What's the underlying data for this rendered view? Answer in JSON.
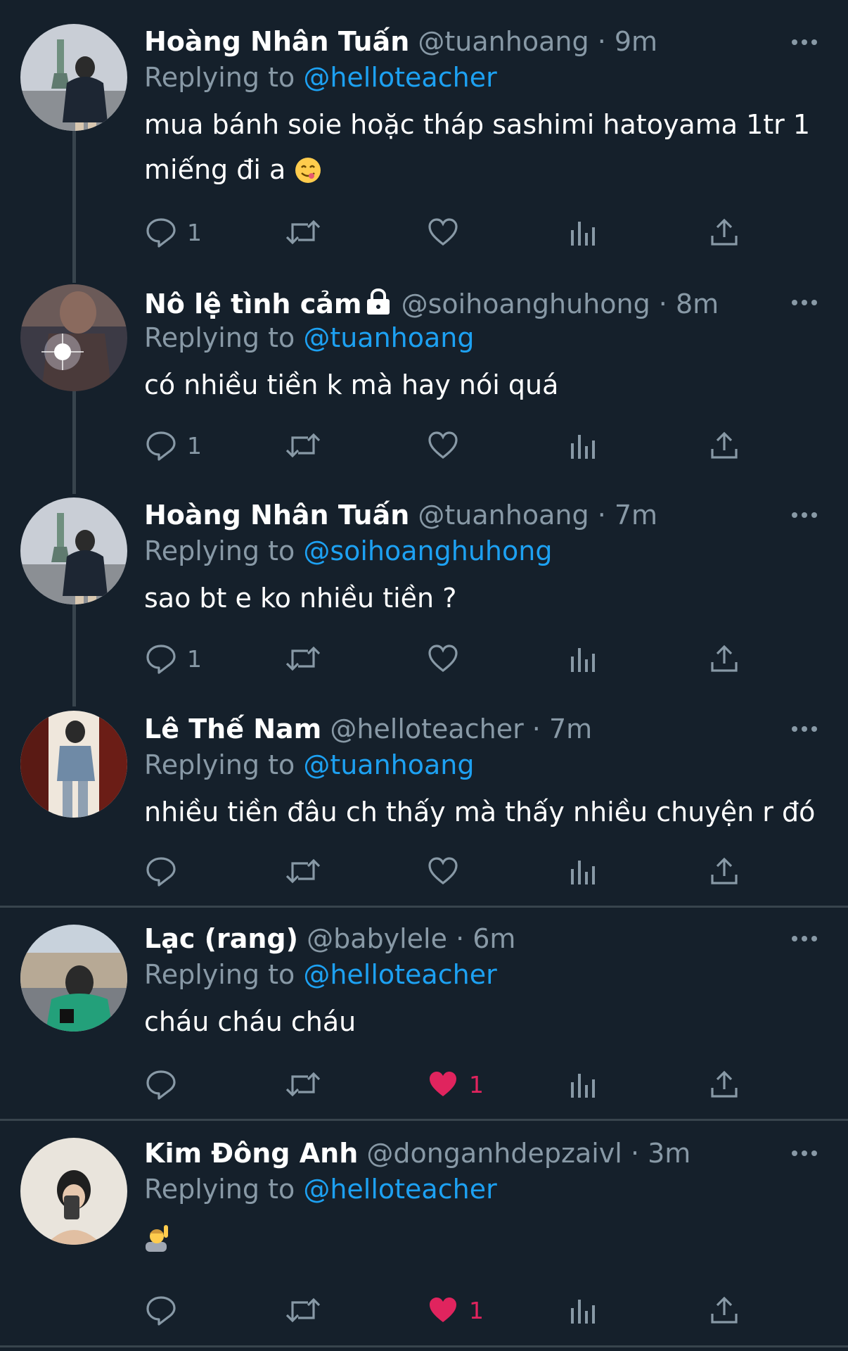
{
  "tweets": [
    {
      "name": "Hoàng Nhân Tuấn",
      "handle": "@tuanhoang",
      "time": "9m",
      "replying_prefix": "Replying to",
      "replying_to": "@helloteacher",
      "text": "mua bánh soie hoặc tháp sashimi hatoyama 1tr 1 miếng đi a",
      "text_emoji": "yum-face-emoji",
      "reply_count": "1",
      "like_count": "",
      "liked": false
    },
    {
      "name": "Nô lệ tình cảm",
      "name_icon": "lock-icon",
      "handle": "@soihoanghuhong",
      "time": "8m",
      "replying_prefix": "Replying to",
      "replying_to": "@tuanhoang",
      "text": "có nhiều tiền k mà hay nói quá",
      "reply_count": "1",
      "like_count": "",
      "liked": false
    },
    {
      "name": "Hoàng Nhân Tuấn",
      "handle": "@tuanhoang",
      "time": "7m",
      "replying_prefix": "Replying to",
      "replying_to": "@soihoanghuhong",
      "text": "sao bt e ko nhiều tiền ?",
      "reply_count": "1",
      "like_count": "",
      "liked": false
    },
    {
      "name": "Lê Thế Nam",
      "handle": "@helloteacher",
      "time": "7m",
      "replying_prefix": "Replying to",
      "replying_to": "@tuanhoang",
      "text": "nhiều tiền đâu ch thấy mà thấy nhiều chuyện r đó",
      "reply_count": "",
      "like_count": "",
      "liked": false
    },
    {
      "name": "Lạc (rang)",
      "handle": "@babylele",
      "time": "6m",
      "replying_prefix": "Replying to",
      "replying_to": "@helloteacher",
      "text": "cháu cháu cháu",
      "reply_count": "",
      "like_count": "1",
      "liked": true
    },
    {
      "name": "Kim Đông Anh",
      "handle": "@donganhdepzaivl",
      "time": "3m",
      "replying_prefix": "Replying to",
      "replying_to": "@helloteacher",
      "text": "",
      "text_emoji": "person-raising-hand-emoji",
      "reply_count": "",
      "like_count": "1",
      "liked": true
    }
  ],
  "separator_dot": "·",
  "colors": {
    "background": "#15202b",
    "text": "#ffffff",
    "secondary": "#8899a6",
    "mention": "#1da1f2",
    "like": "#e0245e",
    "divider": "#38444d"
  }
}
